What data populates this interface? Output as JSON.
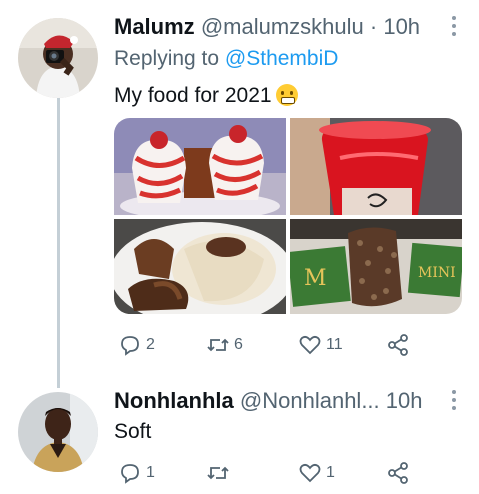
{
  "tweets": [
    {
      "display_name": "Malumz",
      "handle": "@malumzskhulu",
      "separator": "·",
      "time": "10h",
      "reply_prefix": "Replying to",
      "reply_mention": "@SthembiD",
      "text": "My food for 2021",
      "emoji": "grimacing-face",
      "media": [
        "dessert-cones-photo",
        "red-drink-cup-photo",
        "rice-and-meat-plate-photo",
        "magnum-ice-cream-photo"
      ],
      "stats": {
        "replies": "2",
        "retweets": "6",
        "likes": "11"
      }
    },
    {
      "display_name": "Nonhlanhla",
      "handle": "@Nonhlanhl...",
      "separator": "",
      "time": "10h",
      "text": "Soft",
      "stats": {
        "replies": "1",
        "retweets": "",
        "likes": "1"
      }
    }
  ],
  "colors": {
    "accent": "#1d9bf0",
    "secondary_text": "#536471",
    "thread_line": "#c4cfd6"
  },
  "icons": [
    "reply-icon",
    "retweet-icon",
    "like-icon",
    "share-icon",
    "more-icon"
  ]
}
